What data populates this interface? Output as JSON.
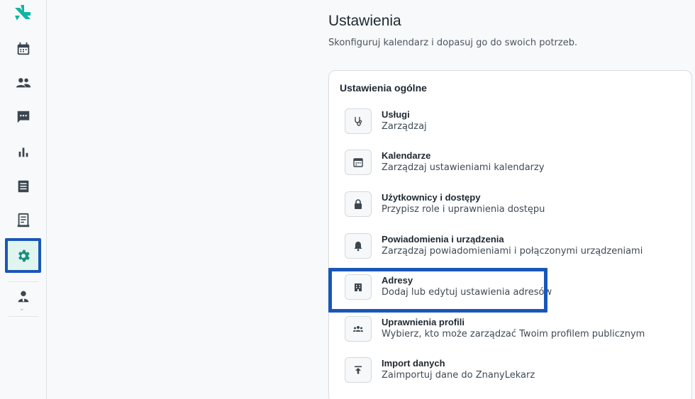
{
  "app": {
    "brand_color": "#12b5a4",
    "highlight_color": "#1a56b8"
  },
  "sidebar": {
    "items": [
      {
        "name": "calendar-icon"
      },
      {
        "name": "patients-icon"
      },
      {
        "name": "messages-icon"
      },
      {
        "name": "stats-icon"
      },
      {
        "name": "billing-icon"
      },
      {
        "name": "records-icon"
      },
      {
        "name": "settings-icon",
        "active": true
      },
      {
        "name": "doctor-profile-icon"
      }
    ],
    "chevron": "⌄"
  },
  "header": {
    "title": "Ustawienia",
    "subtitle": "Skonfiguruj kalendarz i dopasuj go do swoich potrzeb."
  },
  "general": {
    "title": "Ustawienia ogólne",
    "items": [
      {
        "title": "Usługi",
        "desc": "Zarządzaj",
        "icon": "stethoscope-icon"
      },
      {
        "title": "Kalendarze",
        "desc": "Zarządzaj ustawieniami kalendarzy",
        "icon": "calendar-icon"
      },
      {
        "title": "Użytkownicy i dostępy",
        "desc": "Przypisz role i uprawnienia dostępu",
        "icon": "lock-icon"
      },
      {
        "title": "Powiadomienia i urządzenia",
        "desc": "Zarządzaj powiadomieniami i połączonymi urządzeniami",
        "icon": "bell-icon"
      },
      {
        "title": "Adresy",
        "desc": "Dodaj lub edytuj ustawienia adresów",
        "icon": "building-icon"
      },
      {
        "title": "Uprawnienia profili",
        "desc": "Wybierz, kto może zarządzać Twoim profilem publicznym",
        "icon": "group-icon"
      },
      {
        "title": "Import danych",
        "desc": "Zaimportuj dane do ZnanyLekarz",
        "icon": "upload-icon"
      }
    ]
  }
}
